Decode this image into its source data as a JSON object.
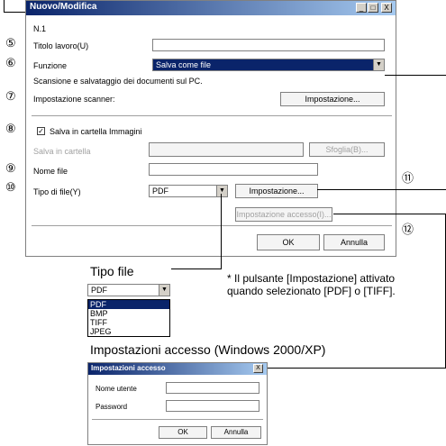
{
  "window": {
    "title": "Nuovo/Modifica",
    "n_label": "N.1",
    "titolo_label": "Titolo lavoro(U)",
    "titolo_value": "",
    "funzione_label": "Funzione",
    "funzione_value": "Salva come file",
    "desc": "Scansione e salvataggio dei documenti sul PC.",
    "scanner_label": "Impostazione scanner:",
    "scanner_button": "Impostazione...",
    "salva_immagini_label": "Salva in cartella Immagini",
    "salva_cartella_label": "Salva in cartella",
    "sfoglia_button": "Sfoglia(B)...",
    "nome_file_label": "Nome file",
    "tipo_file_label": "Tipo di file(Y)",
    "tipo_file_value": "PDF",
    "impostazione_button": "Impostazione...",
    "accesso_button": "Impostazione accesso(I)...",
    "ok_button": "OK",
    "annulla_button": "Annulla",
    "minimize": "_",
    "maximize": "□",
    "close": "X"
  },
  "callouts": {
    "n5": "⑤",
    "n6": "⑥",
    "n7": "⑦",
    "n8": "⑧",
    "n9": "⑨",
    "n10": "⑩",
    "n11": "⑪",
    "n12": "⑫"
  },
  "tipo_file_panel": {
    "caption": "Tipo file",
    "value": "PDF",
    "options": [
      "PDF",
      "BMP",
      "TIFF",
      "JPEG"
    ]
  },
  "note": "* Il pulsante [Impostazione] attivato quando selezionato [PDF] o [TIFF].",
  "accesso_panel": {
    "caption": "Impostazioni accesso (Windows 2000/XP)",
    "title": "Impostazioni accesso",
    "close": "X",
    "nome_utente_label": "Nome utente",
    "password_label": "Password",
    "ok_button": "OK",
    "annulla_button": "Annulla"
  }
}
